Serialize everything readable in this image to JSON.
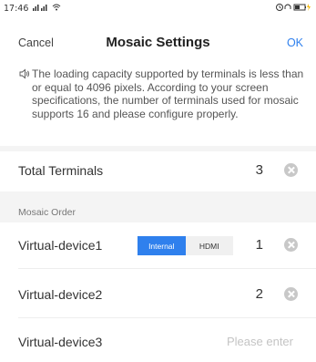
{
  "status_bar": {
    "time": "17:46",
    "left_icons": "⋮|l ⋮|l ⌁",
    "right_icons": "8∩"
  },
  "header": {
    "cancel_label": "Cancel",
    "title": "Mosaic Settings",
    "ok_label": "OK"
  },
  "notice": {
    "icon": "speaker-icon",
    "text": "The loading capacity supported by terminals is less than or equal to 4096 pixels. According to your screen specifications, the number of terminals used for mosaic supports 16 and please configure properly."
  },
  "total_terminals": {
    "label": "Total Terminals",
    "value": "3"
  },
  "mosaic_order": {
    "section_label": "Mosaic Order",
    "devices": [
      {
        "label": "Virtual-device1",
        "value": "1",
        "source_options": [
          "Internal",
          "HDMI"
        ],
        "selected_source": "Internal"
      },
      {
        "label": "Virtual-device2",
        "value": "2"
      },
      {
        "label": "Virtual-device3",
        "placeholder": "Please enter"
      }
    ]
  },
  "colors": {
    "accent": "#2f80ed",
    "section_background": "#f4f4f4",
    "clear_icon": "#c8c8c8"
  }
}
